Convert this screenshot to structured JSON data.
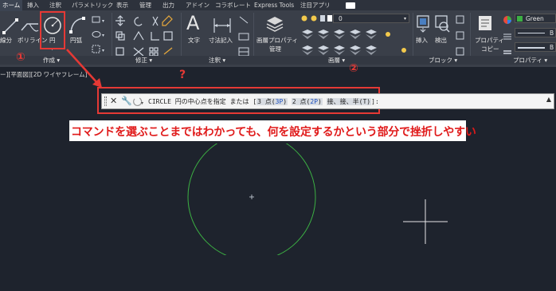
{
  "tabs": [
    "ホーム",
    "挿入",
    "注釈",
    "パラメトリック",
    "表示",
    "管理",
    "出力",
    "アドイン",
    "コラボレート",
    "Express Tools",
    "注目アプリ"
  ],
  "ribbon": {
    "draw_tools": {
      "line": "線分",
      "polyline": "ポリライン",
      "circle": "円",
      "arc": "円弧"
    },
    "panels": {
      "draw": "作成 ▾",
      "modify": "修正 ▾",
      "annotation": "注釈 ▾",
      "layers": "画層 ▾",
      "block": "ブロック ▾",
      "properties": "プロパティ ▾"
    },
    "annotation_tools": {
      "text": "文字",
      "dimension": "寸法記入"
    },
    "layer_tools": {
      "layer_properties_1": "画層プロパティ",
      "layer_properties_2": "管理",
      "layer_value": "0"
    },
    "block_tools": {
      "insert": "挿入",
      "detect": "検出"
    },
    "properties_tools": {
      "match_1": "プロパティ",
      "match_2": "コピー",
      "color": "Green",
      "byblock_1": "B",
      "byblock_2": "B"
    }
  },
  "viewport_label": "ー][平面図][2D ワイヤフレーム]",
  "annotations": {
    "marker_1": "①",
    "marker_2": "②",
    "question": "?"
  },
  "command_line": {
    "prompt_prefix": "CIRCLE 円の中心点を指定 または [",
    "opt1_a": "3 点(",
    "opt1_key": "3P",
    "opt1_b": ")",
    "opt2_a": "2 点(",
    "opt2_key": "2P",
    "opt2_b": ")",
    "opt3": "接、接、半(T)",
    "suffix": "]:"
  },
  "callout_text": "コマンドを選ぶことまではわかっても、何を設定するかという部分で挫折しやすい",
  "colors": {
    "ribbon": "#3a3f49",
    "canvas": "#1e232d",
    "annotation_red": "#e53935",
    "circle_green": "#3cb043"
  }
}
